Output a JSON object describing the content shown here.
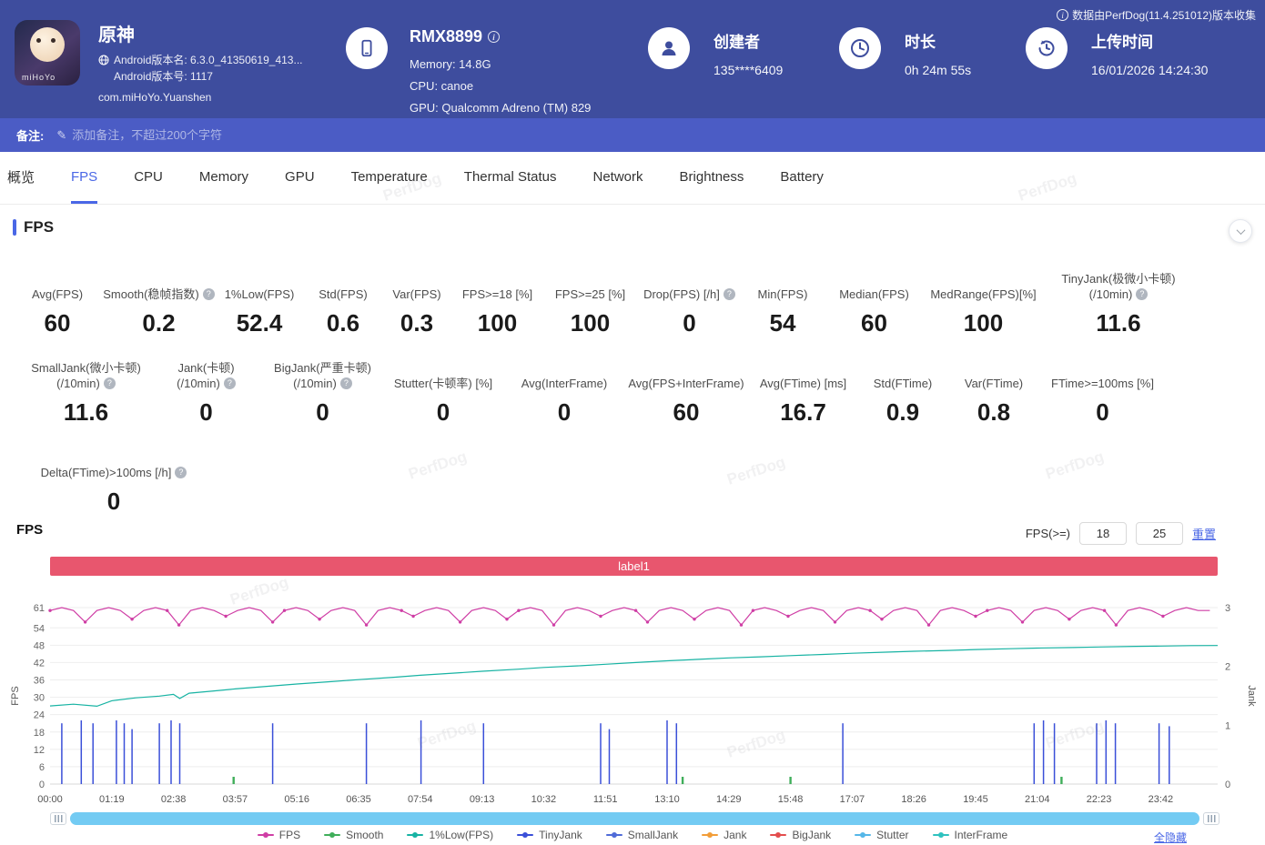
{
  "colors": {
    "header_bg": "#3e4d9e",
    "remark_bg": "#4b5cc5",
    "accent": "#4a67e6",
    "label_bar": "#e8566e",
    "scrollbar": "#73cbf3"
  },
  "watermark": "PerfDog",
  "header": {
    "collect_note": "数据由PerfDog(11.4.251012)版本收集",
    "app": {
      "icon_text": "miHoYo",
      "title": "原神",
      "version_name": "Android版本名: 6.3.0_41350619_413...",
      "version_code": "Android版本号: 1117",
      "package": "com.miHoYo.Yuanshen"
    },
    "device": {
      "name": "RMX8899",
      "memory": "Memory: 14.8G",
      "cpu": "CPU: canoe",
      "gpu": "GPU: Qualcomm Adreno (TM) 829"
    },
    "creator": {
      "label": "创建者",
      "value": "135****6409"
    },
    "duration": {
      "label": "时长",
      "value": "0h 24m 55s"
    },
    "upload": {
      "label": "上传时间",
      "value": "16/01/2026 14:24:30"
    }
  },
  "remark": {
    "label": "备注:",
    "placeholder": "添加备注，不超过200个字符"
  },
  "tabs": {
    "items": [
      "概览",
      "FPS",
      "CPU",
      "Memory",
      "GPU",
      "Temperature",
      "Thermal Status",
      "Network",
      "Brightness",
      "Battery"
    ],
    "active": "FPS"
  },
  "section_title": "FPS",
  "metrics": {
    "rows": [
      [
        {
          "label": "Avg(FPS)",
          "value": "60"
        },
        {
          "label": "Smooth(稳帧指数)",
          "info": true,
          "value": "0.2"
        },
        {
          "label": "1%Low(FPS)",
          "value": "52.4"
        },
        {
          "label": "Std(FPS)",
          "value": "0.6"
        },
        {
          "label": "Var(FPS)",
          "value": "0.3"
        },
        {
          "label": "FPS>=18 [%]",
          "value": "100"
        },
        {
          "label": "FPS>=25 [%]",
          "value": "100"
        },
        {
          "label": "Drop(FPS) [/h]",
          "info": true,
          "value": "0"
        },
        {
          "label": "Min(FPS)",
          "value": "54"
        },
        {
          "label": "Median(FPS)",
          "value": "60"
        },
        {
          "label": "MedRange(FPS)[%]",
          "value": "100"
        },
        {
          "label": "TinyJank(极微小卡顿)",
          "label2": "(/10min)",
          "info": true,
          "value": "11.6"
        }
      ],
      [
        {
          "label": "SmallJank(微小卡顿)",
          "label2": "(/10min)",
          "info": true,
          "value": "11.6"
        },
        {
          "label": "Jank(卡顿)",
          "label2": "(/10min)",
          "info": true,
          "value": "0"
        },
        {
          "label": "BigJank(严重卡顿)",
          "label2": "(/10min)",
          "info": true,
          "value": "0"
        },
        {
          "label": "Stutter(卡顿率) [%]",
          "value": "0"
        },
        {
          "label": "Avg(InterFrame)",
          "value": "0"
        },
        {
          "label": "Avg(FPS+InterFrame)",
          "value": "60"
        },
        {
          "label": "Avg(FTime) [ms]",
          "value": "16.7"
        },
        {
          "label": "Std(FTime)",
          "value": "0.9"
        },
        {
          "label": "Var(FTime)",
          "value": "0.8"
        },
        {
          "label": "FTime>=100ms [%]",
          "value": "0"
        }
      ],
      [
        {
          "label": "Delta(FTime)>100ms [/h]",
          "info": true,
          "value": "0"
        }
      ]
    ]
  },
  "fps_chart": {
    "title": "FPS",
    "filter_label": "FPS(>=)",
    "threshold1": "18",
    "threshold2": "25",
    "reset_label": "重置",
    "hide_all_label": "全隐藏",
    "legend": [
      {
        "label": "FPS",
        "color": "#cf3ea5"
      },
      {
        "label": "Smooth",
        "color": "#3fae5a"
      },
      {
        "label": "1%Low(FPS)",
        "color": "#17b3a3"
      },
      {
        "label": "TinyJank",
        "color": "#3a4fd8"
      },
      {
        "label": "SmallJank",
        "color": "#4f6bd8"
      },
      {
        "label": "Jank",
        "color": "#f29d38"
      },
      {
        "label": "BigJank",
        "color": "#e34d4d"
      },
      {
        "label": "Stutter",
        "color": "#55b7e8"
      },
      {
        "label": "InterFrame",
        "color": "#2fc2bf"
      }
    ]
  },
  "chart_data": {
    "type": "line",
    "title": "label1",
    "duration_s": 1495,
    "x_tick_interval_s": 79,
    "x_ticks": [
      "00:00",
      "01:19",
      "02:38",
      "03:57",
      "05:16",
      "06:35",
      "07:54",
      "09:13",
      "10:32",
      "11:51",
      "13:10",
      "14:29",
      "15:48",
      "17:07",
      "18:26",
      "19:45",
      "21:04",
      "22:23",
      "23:42"
    ],
    "y_left": {
      "label": "FPS",
      "ticks": [
        0,
        6,
        12,
        18,
        24,
        30,
        36,
        42,
        48,
        54,
        61
      ],
      "max": 61
    },
    "y_right": {
      "label": "Jank",
      "ticks": [
        0,
        1,
        2,
        3
      ],
      "max": 3
    },
    "series": [
      {
        "name": "FPS",
        "color": "#cf3ea5",
        "axis": "left",
        "type": "line",
        "dt_s": 15,
        "values": [
          60,
          61,
          60,
          56,
          60,
          61,
          60,
          57,
          60,
          61,
          60,
          55,
          60,
          61,
          60,
          58,
          60,
          61,
          60,
          56,
          60,
          61,
          60,
          57,
          60,
          61,
          60,
          55,
          60,
          61,
          60,
          58,
          60,
          61,
          60,
          56,
          60,
          61,
          60,
          57,
          60,
          61,
          60,
          55,
          60,
          61,
          60,
          58,
          60,
          61,
          60,
          56,
          60,
          61,
          60,
          57,
          60,
          61,
          60,
          55,
          60,
          61,
          60,
          58,
          60,
          61,
          60,
          56,
          60,
          61,
          60,
          57,
          60,
          61,
          60,
          55,
          60,
          61,
          60,
          58,
          60,
          61,
          60,
          56,
          60,
          61,
          60,
          57,
          60,
          61,
          60,
          55,
          60,
          61,
          60,
          58,
          60,
          61,
          60,
          60
        ]
      },
      {
        "name": "1%Low(FPS)",
        "color": "#17b3a3",
        "axis": "left",
        "type": "line",
        "points": [
          [
            0,
            27
          ],
          [
            30,
            27.6
          ],
          [
            60,
            26.9
          ],
          [
            79,
            28.8
          ],
          [
            110,
            29.8
          ],
          [
            140,
            30.4
          ],
          [
            158,
            31
          ],
          [
            166,
            29.6
          ],
          [
            178,
            31.4
          ],
          [
            210,
            32.2
          ],
          [
            237,
            32.9
          ],
          [
            270,
            33.6
          ],
          [
            316,
            34.6
          ],
          [
            360,
            35.4
          ],
          [
            395,
            36.1
          ],
          [
            440,
            36.9
          ],
          [
            474,
            37.6
          ],
          [
            520,
            38.4
          ],
          [
            553,
            39
          ],
          [
            600,
            39.7
          ],
          [
            632,
            40.3
          ],
          [
            680,
            40.9
          ],
          [
            711,
            41.4
          ],
          [
            750,
            42
          ],
          [
            790,
            42.6
          ],
          [
            830,
            43.1
          ],
          [
            869,
            43.6
          ],
          [
            910,
            44
          ],
          [
            948,
            44.4
          ],
          [
            990,
            44.8
          ],
          [
            1027,
            45.2
          ],
          [
            1070,
            45.6
          ],
          [
            1106,
            45.9
          ],
          [
            1150,
            46.2
          ],
          [
            1185,
            46.5
          ],
          [
            1230,
            46.8
          ],
          [
            1264,
            47
          ],
          [
            1310,
            47.2
          ],
          [
            1343,
            47.4
          ],
          [
            1390,
            47.6
          ],
          [
            1422,
            47.7
          ],
          [
            1460,
            47.85
          ],
          [
            1495,
            47.9
          ]
        ]
      },
      {
        "name": "TinyJank",
        "color": "#3a4fd8",
        "axis": "left",
        "type": "spike",
        "points": [
          [
            15,
            21
          ],
          [
            40,
            22
          ],
          [
            55,
            21
          ],
          [
            85,
            22
          ],
          [
            95,
            21
          ],
          [
            105,
            19
          ],
          [
            140,
            21
          ],
          [
            155,
            22
          ],
          [
            166,
            21
          ],
          [
            285,
            21
          ],
          [
            405,
            21
          ],
          [
            475,
            22
          ],
          [
            555,
            21
          ],
          [
            705,
            21
          ],
          [
            716,
            19
          ],
          [
            790,
            22
          ],
          [
            802,
            21
          ],
          [
            1015,
            21
          ],
          [
            1260,
            21
          ],
          [
            1272,
            22
          ],
          [
            1286,
            21
          ],
          [
            1340,
            21
          ],
          [
            1352,
            22
          ],
          [
            1364,
            21
          ],
          [
            1420,
            21
          ],
          [
            1433,
            20
          ]
        ]
      },
      {
        "name": "Smooth",
        "color": "#3fae5a",
        "axis": "left",
        "type": "spike",
        "points": [
          [
            235,
            2.5
          ],
          [
            810,
            2.5
          ],
          [
            948,
            2.5
          ],
          [
            1295,
            2.5
          ]
        ]
      }
    ]
  }
}
